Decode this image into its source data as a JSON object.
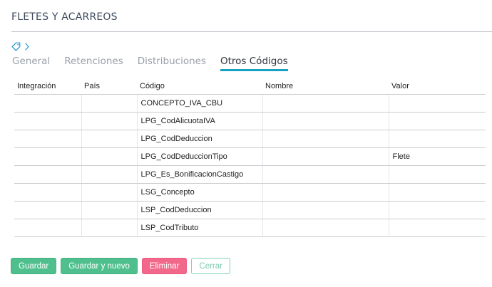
{
  "page": {
    "title": "FLETES Y ACARREOS"
  },
  "tabs": [
    {
      "label": "General",
      "active": false
    },
    {
      "label": "Retenciones",
      "active": false
    },
    {
      "label": "Distribuciones",
      "active": false
    },
    {
      "label": "Otros Códigos",
      "active": true
    }
  ],
  "table": {
    "headers": [
      "Integración",
      "País",
      "Código",
      "Nombre",
      "Valor"
    ],
    "rows": [
      [
        "",
        "",
        "CONCEPTO_IVA_CBU",
        "",
        ""
      ],
      [
        "",
        "",
        "LPG_CodAlicuotaIVA",
        "",
        ""
      ],
      [
        "",
        "",
        "LPG_CodDeduccion",
        "",
        ""
      ],
      [
        "",
        "",
        "LPG_CodDeduccionTipo",
        "",
        "Flete"
      ],
      [
        "",
        "",
        "LPG_Es_BonificacionCastigo",
        "",
        ""
      ],
      [
        "",
        "",
        "LSG_Concepto",
        "",
        ""
      ],
      [
        "",
        "",
        "LSP_CodDeduccion",
        "",
        ""
      ],
      [
        "",
        "",
        "LSP_CodTributo",
        "",
        ""
      ]
    ]
  },
  "actions": {
    "save": "Guardar",
    "save_new": "Guardar y nuevo",
    "delete": "Eliminar",
    "close": "Cerrar"
  },
  "colors": {
    "accent": "#17a2c4",
    "save": "#4fc08d",
    "delete": "#f2688a",
    "close_border": "#7fd0b3"
  },
  "icons": {
    "tag": "tag-icon",
    "chevron": "chevron-right-icon"
  }
}
